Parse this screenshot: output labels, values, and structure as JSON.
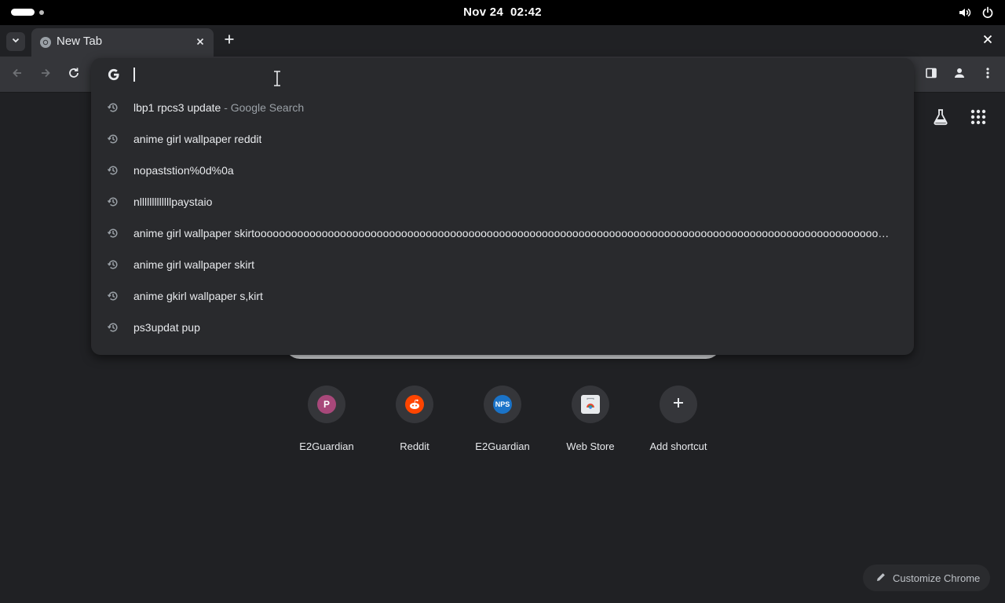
{
  "topbar": {
    "clock_date": "Nov 24",
    "clock_time": "02:42"
  },
  "tabs": [
    {
      "title": "New Tab"
    }
  ],
  "omnibox": {
    "value": "",
    "suggestions": [
      {
        "text": "lbp1 rpcs3 update",
        "suffix": " - Google Search"
      },
      {
        "text": "anime girl wallpaper reddit",
        "suffix": ""
      },
      {
        "text": "nopaststion%0d%0a",
        "suffix": ""
      },
      {
        "text": "nlllllllllllllpaystaio",
        "suffix": ""
      },
      {
        "text": "anime girl wallpaper skirtoooooooooooooooooooooooooooooooooooooooooooooooooooooooooooooooooooooooooooooooooooooooooooooooooooooooooooooooooooooooooooooooooooooooooo",
        "suffix": ""
      },
      {
        "text": "anime girl wallpaper skirt",
        "suffix": ""
      },
      {
        "text": "anime gkirl wallpaper s,kirt",
        "suffix": ""
      },
      {
        "text": "ps3updat pup",
        "suffix": ""
      }
    ]
  },
  "shortcuts": [
    {
      "label": "E2Guardian",
      "glyph": "P",
      "color": "#a8487a"
    },
    {
      "label": "Reddit",
      "glyph": "reddit",
      "color": "#ff4500"
    },
    {
      "label": "E2Guardian",
      "glyph": "NPS",
      "color": "#1a73c8"
    },
    {
      "label": "Web Store",
      "glyph": "store",
      "color": "#e8eaed"
    },
    {
      "label": "Add shortcut",
      "glyph": "+",
      "color": "#35363a"
    }
  ],
  "customize_label": "Customize Chrome",
  "icons": {
    "search_provider": "google-g-icon",
    "history": "history-icon",
    "labs": "flask-icon",
    "apps": "grid-icon"
  }
}
